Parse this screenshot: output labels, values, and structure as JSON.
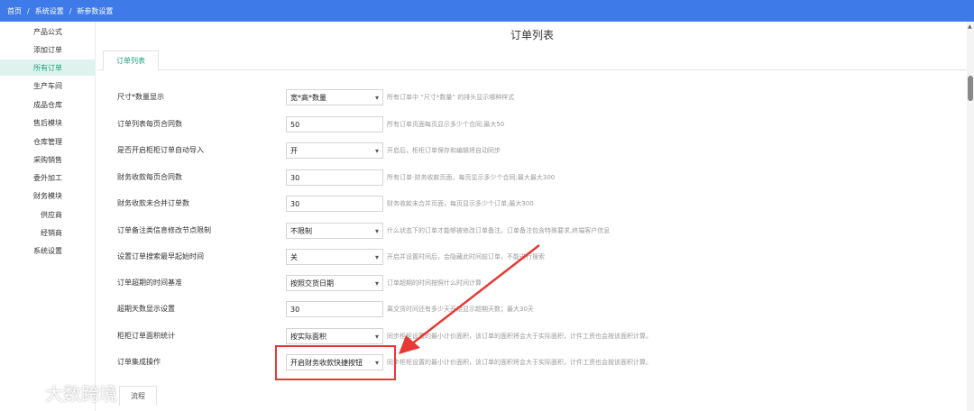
{
  "breadcrumb": {
    "home": "首页",
    "separator": "/",
    "level1": "系统设置",
    "level2": "新参数设置"
  },
  "sidebar": {
    "items": [
      {
        "label": "产品公式",
        "active": false
      },
      {
        "label": "添加订单",
        "active": false
      },
      {
        "label": "所有订单",
        "active": true
      },
      {
        "label": "生产车间",
        "active": false
      },
      {
        "label": "成品仓库",
        "active": false
      },
      {
        "label": "售后模块",
        "active": false
      },
      {
        "label": "仓库管理",
        "active": false
      },
      {
        "label": "采购销售",
        "active": false
      },
      {
        "label": "委外加工",
        "active": false
      },
      {
        "label": "财务模块",
        "active": false
      },
      {
        "label": "供应商",
        "active": false
      },
      {
        "label": "经销商",
        "active": false
      },
      {
        "label": "系统设置",
        "active": false
      }
    ]
  },
  "page": {
    "title": "订单列表",
    "tab": "订单列表",
    "bottom_tab": "流程"
  },
  "settings": [
    {
      "label": "尺寸*数量显示",
      "type": "select",
      "value": "宽*高*数量",
      "hint": "所有订单中 “尺寸*数量” 的排头显示哪种样式"
    },
    {
      "label": "订单列表每页合同数",
      "type": "input",
      "value": "50",
      "hint": "所有订单页面每页显示多少个合同;最大50"
    },
    {
      "label": "是否开启柜柜订单自动导入",
      "type": "select",
      "value": "开",
      "hint": "开启后，柜柜订单保存和编辑将自动同步"
    },
    {
      "label": "财务收款每页合同数",
      "type": "input",
      "value": "30",
      "hint": "所有订单-财务收款页面，每页显示多少个合同;最大最大300"
    },
    {
      "label": "财务收款未合并订单数",
      "type": "input",
      "value": "30",
      "hint": "财务收款未合并页面，每页显示多少个订单;最大300"
    },
    {
      "label": "订单备注类信息修改节点限制",
      "type": "select",
      "value": "不限制",
      "hint": "什么状态下的订单才能够被修改订单备注。订单备注包含特殊要求,终端客户信息"
    },
    {
      "label": "设置订单搜索最早起始时间",
      "type": "select",
      "value": "关",
      "hint": "开启并设置时间后，会隐藏此时间前订单，不能进行搜索"
    },
    {
      "label": "订单超期的时间基准",
      "type": "select",
      "value": "按照交货日期",
      "hint": "订单超期的时间按照什么时间计算"
    },
    {
      "label": "超期天数显示设置",
      "type": "input",
      "value": "30",
      "hint": "离交货时间还有多少天开始显示超期天数；最大30天"
    },
    {
      "label": "柜柜订单面积统计",
      "type": "select",
      "value": "按实际面积",
      "hint": "同步柜柜设置的最小计价面积，该订单的面积将会大于实际面积，计件工资也会按该面积计算。"
    },
    {
      "label": "订单集成操作",
      "type": "select",
      "value": "开启财务收款快捷按钮",
      "hint": "同步柜柜设置的最小计价面积，该订单的面积将会大于实际面积，计件工资也会按该面积计算。"
    }
  ],
  "watermark": {
    "text": "大数跨境"
  },
  "colors": {
    "topbar": "#3f7be8",
    "accent": "#1aa37a",
    "highlight": "#e53935"
  }
}
